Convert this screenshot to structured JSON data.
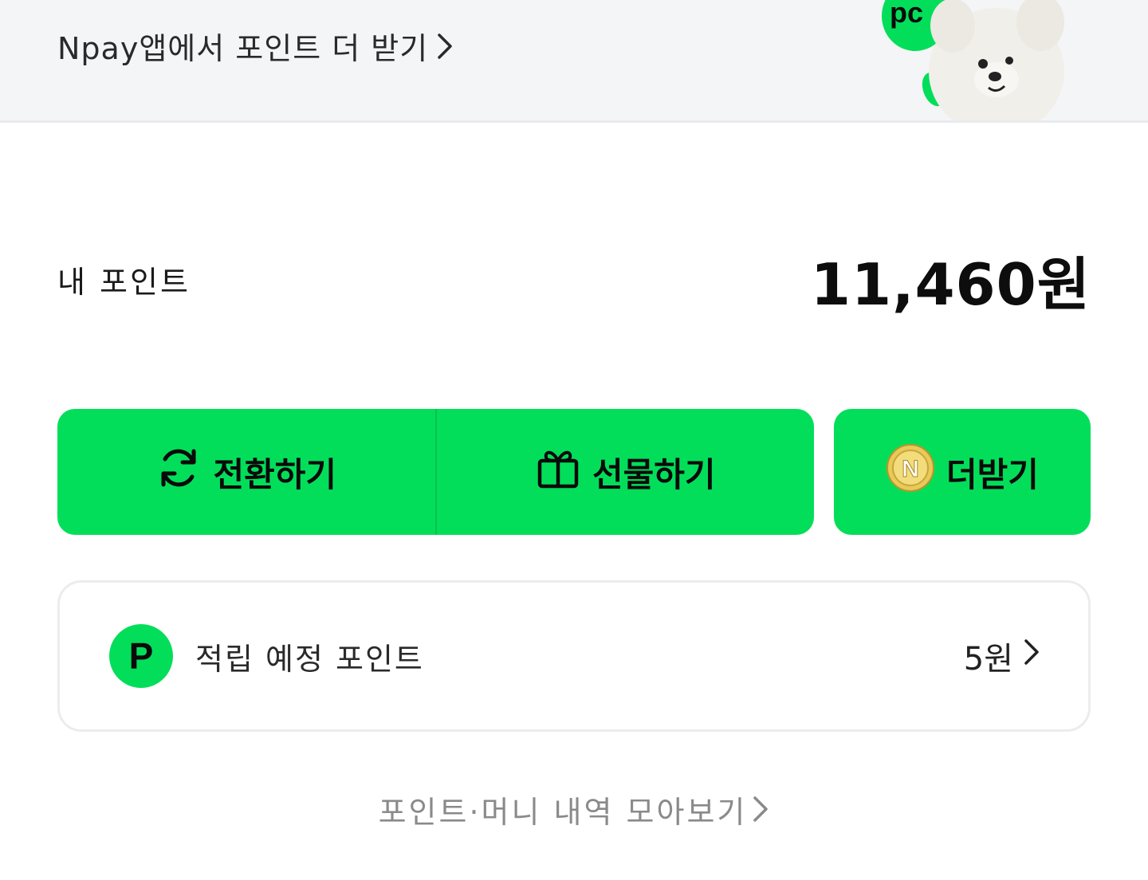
{
  "banner": {
    "link_text": "Npay앱에서 포인트 더 받기",
    "mascot_badge": "pc"
  },
  "points": {
    "label": "내 포인트",
    "value": "11,460원"
  },
  "actions": {
    "convert_label": "전환하기",
    "gift_label": "선물하기",
    "more_label": "더받기"
  },
  "pending": {
    "badge": "P",
    "label": "적립 예정 포인트",
    "value": "5원"
  },
  "history": {
    "link_text": "포인트·머니 내역 모아보기"
  },
  "colors": {
    "accent": "#03de5a",
    "banner_bg": "#f4f5f7"
  }
}
